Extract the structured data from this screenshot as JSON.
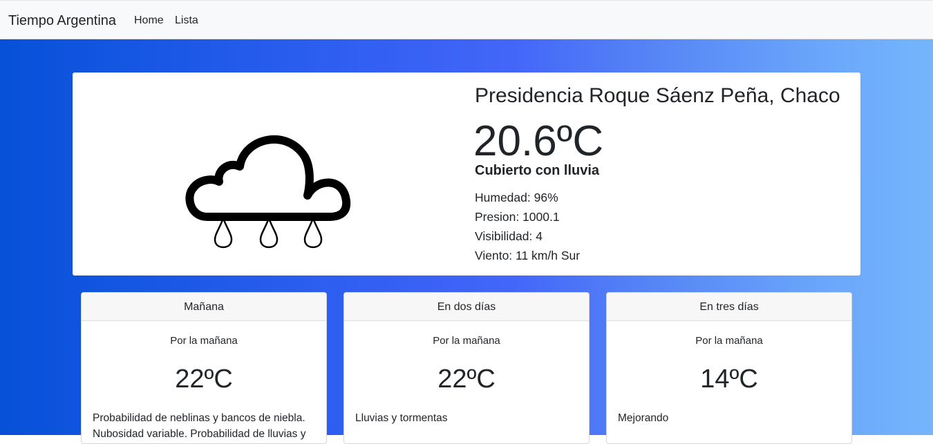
{
  "navbar": {
    "brand": "Tiempo Argentina",
    "links": [
      "Home",
      "Lista"
    ]
  },
  "current": {
    "city": "Presidencia Roque Sáenz Peña, Chaco",
    "temperature": "20.6ºC",
    "condition": "Cubierto con lluvia",
    "icon": "cloud-rain-icon",
    "details": {
      "humidity": "Humedad: 96%",
      "pressure": "Presion: 1000.1",
      "visibility": "Visibilidad: 4",
      "wind": "Viento: 11 km/h Sur"
    }
  },
  "forecast": [
    {
      "title": "Mañana",
      "period": "Por la mañana",
      "temperature": "22ºC",
      "description": "Probabilidad de neblinas y bancos de niebla. Nubosidad variable. Probabilidad de lluvias y"
    },
    {
      "title": "En dos días",
      "period": "Por la mañana",
      "temperature": "22ºC",
      "description": "Lluvias y tormentas"
    },
    {
      "title": "En tres días",
      "period": "Por la mañana",
      "temperature": "14ºC",
      "description": "Mejorando"
    }
  ],
  "colors": {
    "navbar_bg": "#f8f9fa",
    "gradient_start": "#0651d8",
    "gradient_mid": "#4366f8",
    "gradient_end": "#75b5fc"
  }
}
